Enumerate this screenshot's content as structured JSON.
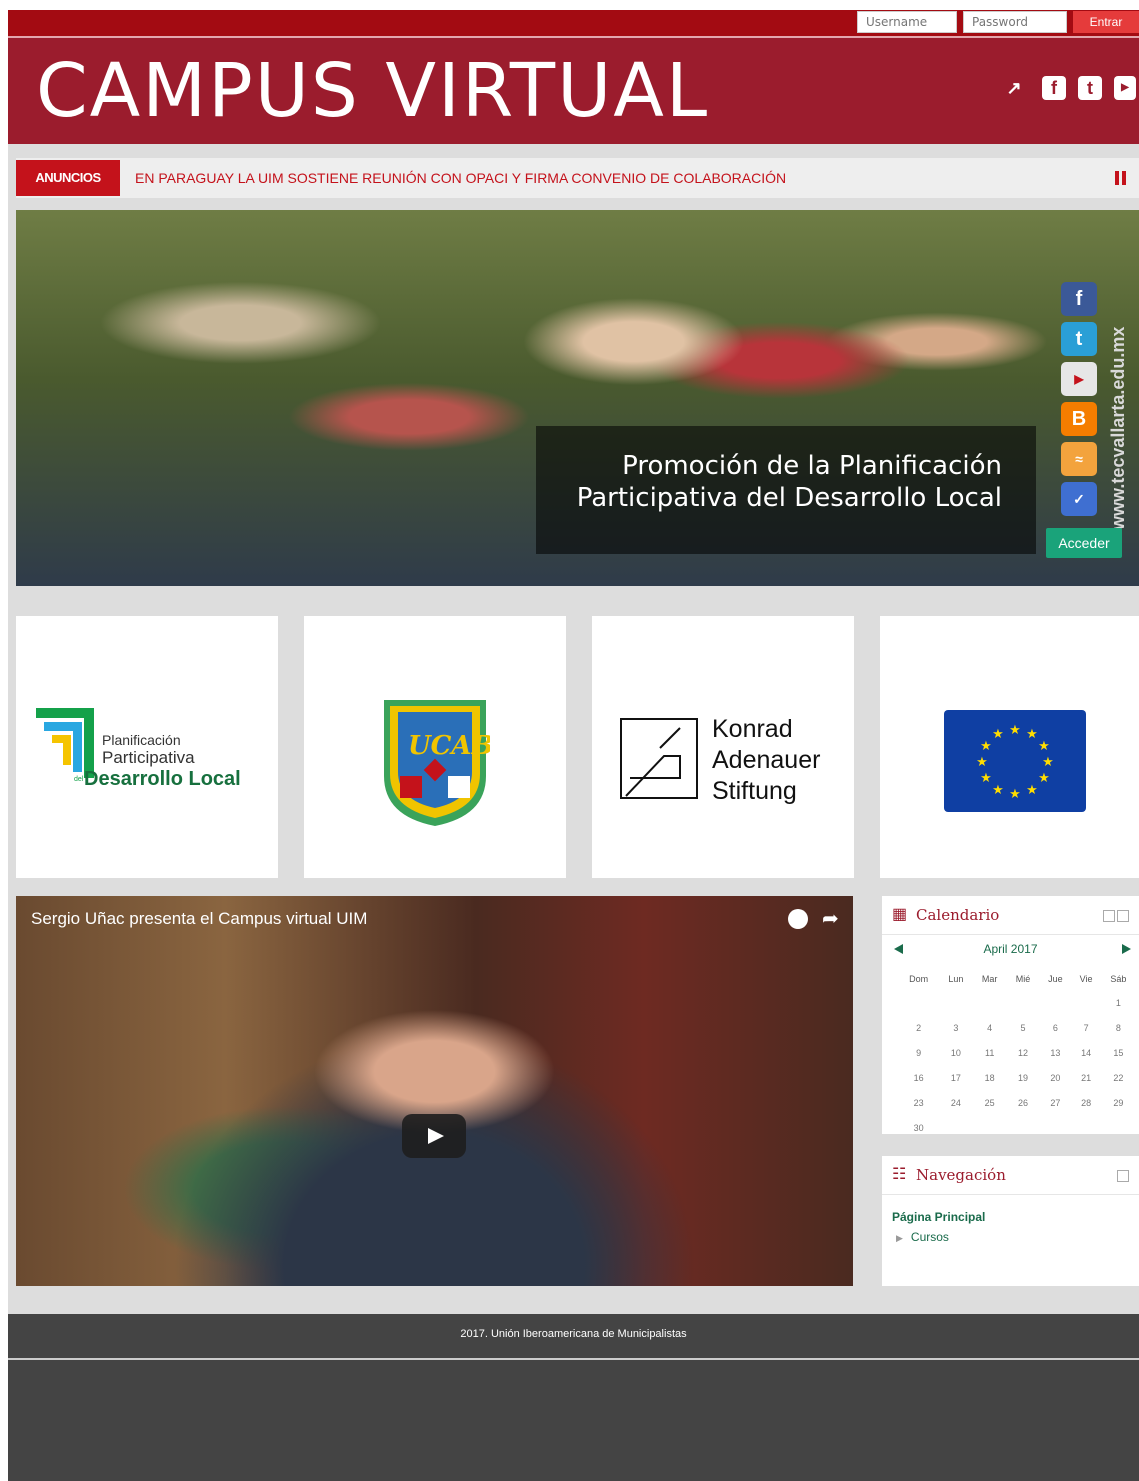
{
  "topbar": {
    "username_placeholder": "Username",
    "password_placeholder": "Password",
    "login_label": "Entrar"
  },
  "header": {
    "title": "CAMPUS VIRTUAL",
    "icons": [
      "external-link-icon",
      "facebook-icon",
      "twitter-icon",
      "youtube-icon"
    ]
  },
  "announcements": {
    "label": "ANUNCIOS",
    "text": "EN PARAGUAY LA UIM SOSTIENE REUNIÓN CON OPACI Y FIRMA CONVENIO DE COLABORACIÓN"
  },
  "hero": {
    "caption": "Promoción de la Planificación Participativa del Desarrollo Local",
    "button_label": "Acceder",
    "watermark": "www.tecvallarta.edu.mx",
    "social": [
      "facebook-icon",
      "twitter-icon",
      "youtube-icon",
      "blogger-icon",
      "rss-icon",
      "delicious-icon"
    ]
  },
  "logos": {
    "pdl": {
      "line1": "Planificación",
      "line2": "Participativa",
      "prefix": "del",
      "line3": "Desarrollo Local"
    },
    "ucab": {
      "text": "UCAB"
    },
    "kas": {
      "line1": "Konrad",
      "line2": "Adenauer",
      "line3": "Stiftung"
    },
    "eu": {
      "name": "eu-flag-icon"
    }
  },
  "video": {
    "title": "Sergio Uñac presenta el Campus virtual UIM"
  },
  "calendar": {
    "title": "Calendario",
    "month": "April 2017",
    "days": [
      "Dom",
      "Lun",
      "Mar",
      "Mié",
      "Jue",
      "Vie",
      "Sáb"
    ],
    "weeks": [
      [
        "",
        "",
        "",
        "",
        "",
        "",
        "1"
      ],
      [
        "2",
        "3",
        "4",
        "5",
        "6",
        "7",
        "8"
      ],
      [
        "9",
        "10",
        "11",
        "12",
        "13",
        "14",
        "15"
      ],
      [
        "16",
        "17",
        "18",
        "19",
        "20",
        "21",
        "22"
      ],
      [
        "23",
        "24",
        "25",
        "26",
        "27",
        "28",
        "29"
      ],
      [
        "30",
        "",
        "",
        "",
        "",
        "",
        ""
      ]
    ]
  },
  "navigation": {
    "title": "Navegación",
    "home": "Página Principal",
    "courses": "Cursos"
  },
  "footer": {
    "text": "2017. Unión Iberoamericana de Municipalistas"
  },
  "colors": {
    "brand": "#9b1c2d",
    "announce": "#c4121b",
    "accent_green": "#1aa37a",
    "footer": "#444444"
  }
}
